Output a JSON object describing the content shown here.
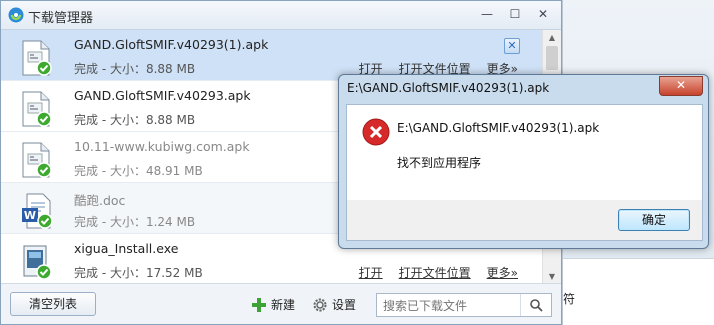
{
  "window": {
    "title": "下载管理器",
    "minimize": "—",
    "maximize": "☐",
    "close": "✕"
  },
  "downloads": [
    {
      "name": "GAND.GloftSMIF.v40293(1).apk",
      "status": "完成 - 大小：8.88 MB",
      "open": "打开",
      "open_folder": "打开文件位置",
      "more": "更多»",
      "icon": "apk-file-icon",
      "selected": true
    },
    {
      "name": "GAND.GloftSMIF.v40293.apk",
      "status": "完成 - 大小：8.88 MB",
      "icon": "apk-file-icon"
    },
    {
      "name": "10.11-www.kubiwg.com.apk",
      "status": "完成 - 大小：48.91 MB",
      "icon": "apk-file-icon"
    },
    {
      "name": "酷跑.doc",
      "status": "完成 - 大小：1.24 MB",
      "icon": "word-doc-icon"
    },
    {
      "name": "xigua_Install.exe",
      "status": "完成 - 大小：17.52 MB",
      "open": "打开",
      "open_folder": "打开文件位置",
      "more": "更多»",
      "icon": "exe-file-icon"
    }
  ],
  "footer": {
    "clear_list": "清空列表",
    "new": "新建",
    "settings": "设置",
    "search_placeholder": "搜索已下载文件"
  },
  "dialog": {
    "title": "E:\\GAND.GloftSMIF.v40293(1).apk",
    "path": "E:\\GAND.GloftSMIF.v40293(1).apk",
    "message": "找不到应用程序",
    "ok": "确定",
    "close": "✕"
  },
  "background": {
    "partial_text": "符"
  },
  "colors": {
    "selected_row": "#cfe1f6",
    "error_red": "#d62a2a",
    "check_green": "#3daa2f"
  }
}
